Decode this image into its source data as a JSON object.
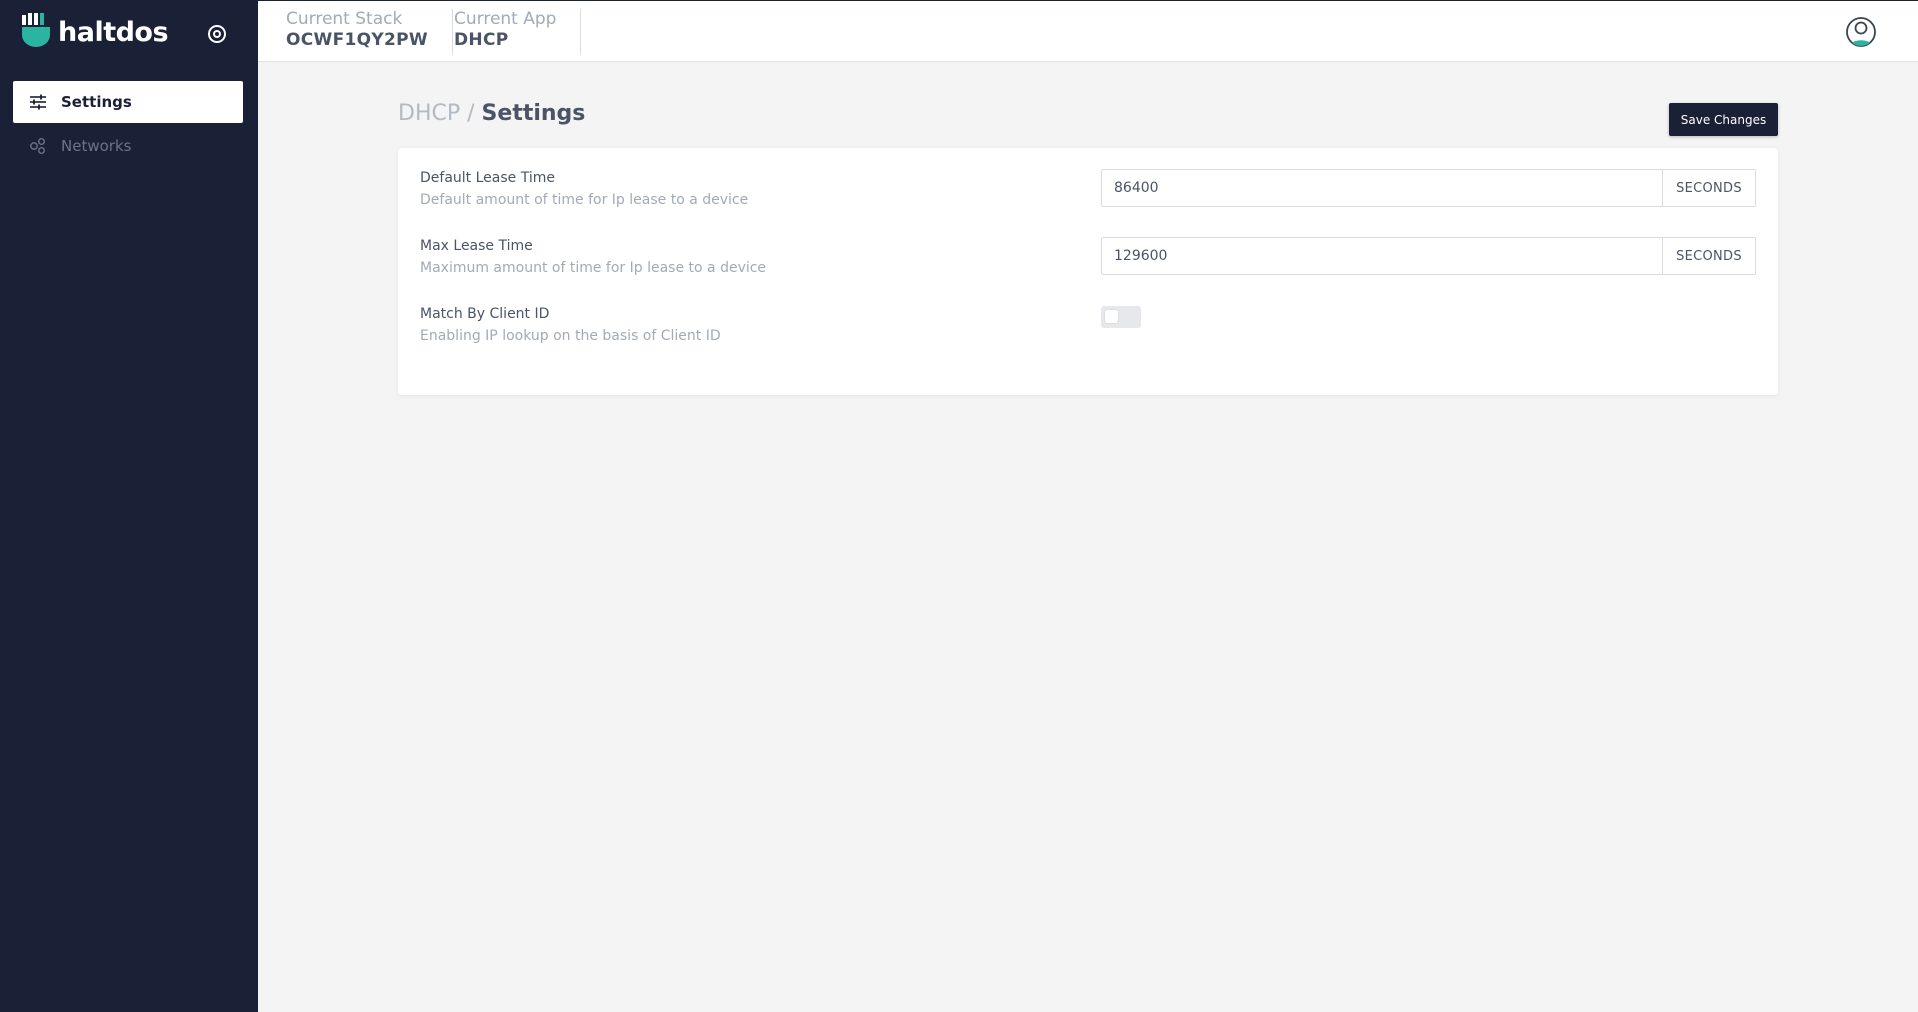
{
  "brand": {
    "name": "haltdos"
  },
  "sidebar": {
    "items": [
      {
        "label": "Settings",
        "icon": "sliders-icon",
        "active": true
      },
      {
        "label": "Networks",
        "icon": "network-nodes-icon",
        "active": false
      }
    ]
  },
  "topbar": {
    "stack_label": "Current Stack",
    "stack_value": "OCWF1QY2PW",
    "app_label": "Current App",
    "app_value": "DHCP",
    "avatar_icon": "user-avatar-icon"
  },
  "page": {
    "breadcrumb_parent": "DHCP",
    "breadcrumb_separator": "/",
    "breadcrumb_current": "Settings",
    "save_label": "Save Changes"
  },
  "settings": {
    "default_lease": {
      "label": "Default Lease Time",
      "description": "Default amount of time for Ip lease to a device",
      "value": "86400",
      "unit": "SECONDS"
    },
    "max_lease": {
      "label": "Max Lease Time",
      "description": "Maximum amount of time for Ip lease to a device",
      "value": "129600",
      "unit": "SECONDS"
    },
    "match_client_id": {
      "label": "Match By Client ID",
      "description": "Enabling IP lookup on the basis of Client ID",
      "enabled": false
    }
  },
  "colors": {
    "sidebar_bg": "#1a2035",
    "brand_accent": "#2bb5a0",
    "page_bg": "#f3f4f3"
  }
}
